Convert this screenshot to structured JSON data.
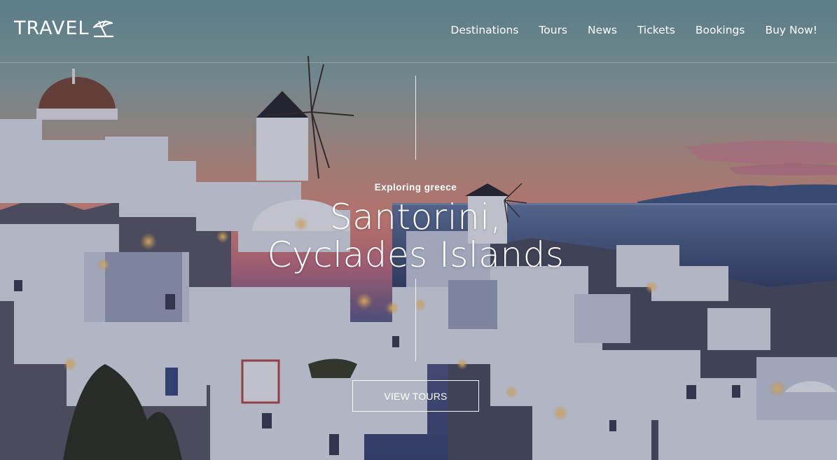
{
  "brand": {
    "name": "TRAVEL",
    "icon": "beach-umbrella-icon"
  },
  "nav": {
    "items": [
      {
        "label": "Destinations"
      },
      {
        "label": "Tours"
      },
      {
        "label": "News"
      },
      {
        "label": "Tickets"
      },
      {
        "label": "Bookings"
      },
      {
        "label": "Buy Now!"
      }
    ]
  },
  "hero": {
    "eyebrow": "Exploring greece",
    "title_line1": "Santorini,",
    "title_line2": "Cyclades Islands",
    "cta_label": "VIEW TOURS",
    "background": "santorini-sunset-photo"
  },
  "colors": {
    "sky_top": "#7a9ea6",
    "sky_sunset": "#e08a7a",
    "sea": "#4a5f86",
    "buildings": "#dfe3f0",
    "text": "#ffffff"
  }
}
